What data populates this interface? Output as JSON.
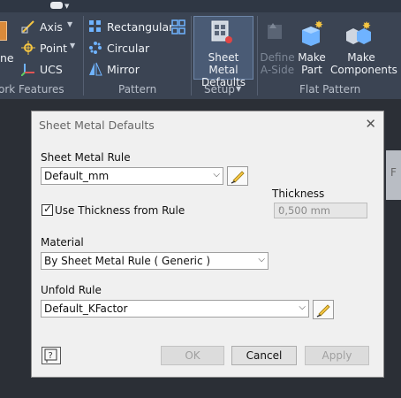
{
  "ribbon": {
    "work_features": {
      "partial_left": "ne",
      "items": [
        "Axis",
        "Point",
        "UCS"
      ],
      "panel_label": "ork Features"
    },
    "pattern": {
      "items": [
        "Rectangular",
        "Circular",
        "Mirror"
      ],
      "panel_label": "Pattern"
    },
    "setup": {
      "sheet_metal_defaults": [
        "Sheet Metal",
        "Defaults"
      ],
      "panel_label": "Setup"
    },
    "flat_pattern": {
      "define_a_side": [
        "Define",
        "A-Side"
      ],
      "make_part": [
        "Make",
        "Part"
      ],
      "make_components": [
        "Make",
        "Components"
      ],
      "panel_label": "Flat Pattern"
    }
  },
  "dialog": {
    "title": "Sheet Metal Defaults",
    "sheet_metal_rule_label": "Sheet Metal Rule",
    "sheet_metal_rule_value": "Default_mm",
    "use_thickness_label": "Use Thickness from Rule",
    "use_thickness_checked": true,
    "thickness_label": "Thickness",
    "thickness_value": "0,500 mm",
    "material_label": "Material",
    "material_value": "By Sheet Metal Rule ( Generic )",
    "unfold_rule_label": "Unfold Rule",
    "unfold_rule_value": "Default_KFactor",
    "ok_label": "OK",
    "cancel_label": "Cancel",
    "apply_label": "Apply"
  },
  "background_window": {
    "partial_text": "F"
  },
  "colors": {
    "ribbon_bg": "#3b4453",
    "canvas_bg": "#2b2f36",
    "dialog_bg": "#f0f0f0",
    "accent_blue": "#6fb3ff",
    "icon_yellow": "#f5c542"
  }
}
